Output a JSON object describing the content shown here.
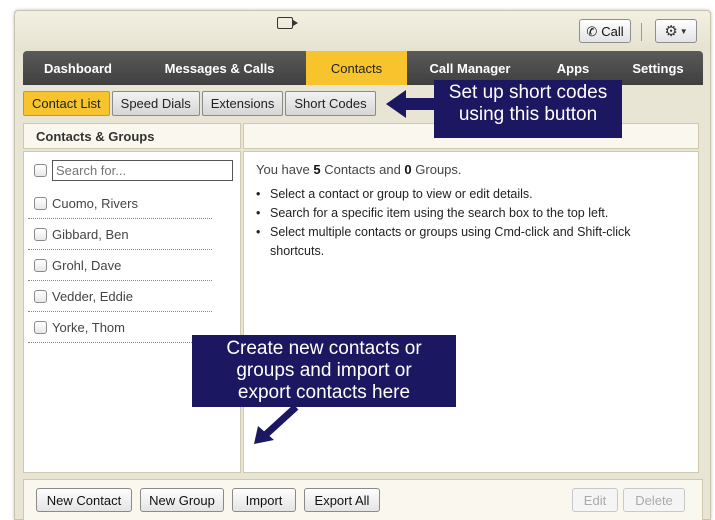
{
  "toolbar": {
    "call_label": "Call",
    "icons": [
      "video-icon",
      "phone-icon",
      "gear-icon",
      "chevron-down-icon"
    ]
  },
  "nav": {
    "items": [
      {
        "label": "Dashboard",
        "active": false
      },
      {
        "label": "Messages & Calls",
        "active": false
      },
      {
        "label": "Contacts",
        "active": true
      },
      {
        "label": "Call Manager",
        "active": false
      },
      {
        "label": "Apps",
        "active": false
      },
      {
        "label": "Settings",
        "active": false
      }
    ]
  },
  "subtabs": [
    {
      "label": "Contact List",
      "active": true
    },
    {
      "label": "Speed Dials",
      "active": false
    },
    {
      "label": "Extensions",
      "active": false
    },
    {
      "label": "Short Codes",
      "active": false
    }
  ],
  "left_panel": {
    "header": "Contacts & Groups",
    "search_placeholder": "Search for...",
    "contacts": [
      "Cuomo, Rivers",
      "Gibbard, Ben",
      "Grohl, Dave",
      "Vedder, Eddie",
      "Yorke, Thom"
    ]
  },
  "right_panel": {
    "summary": {
      "prefix": "You have ",
      "contacts_count": "5",
      "middle": " Contacts and ",
      "groups_count": "0",
      "suffix": " Groups."
    },
    "bullets": [
      "Select a contact or group to view or edit details.",
      "Search for a specific item using the search box to the top left.",
      "Select multiple contacts or groups using Cmd-click and Shift-click shortcuts."
    ]
  },
  "bottom_bar": {
    "new_contact": "New Contact",
    "new_group": "New Group",
    "import": "Import",
    "export_all": "Export All",
    "edit": "Edit",
    "delete": "Delete"
  },
  "annotations": {
    "short_codes_line1": "Set up short codes",
    "short_codes_line2": "using this button",
    "contacts_line1": "Create new contacts or",
    "contacts_line2": "groups and import or",
    "contacts_line3": "export contacts here"
  },
  "colors": {
    "accent": "#f7c42e",
    "nav_background": "#474747",
    "callout_background": "#1b1760"
  }
}
